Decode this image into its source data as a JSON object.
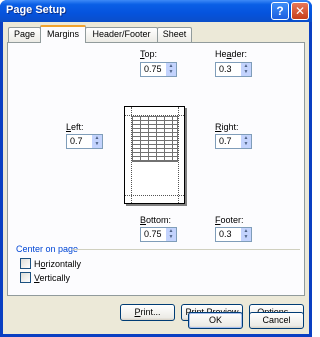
{
  "window": {
    "title": "Page Setup",
    "help_glyph": "?",
    "close_glyph": "✕"
  },
  "tabs": [
    {
      "label": "Page",
      "active": false
    },
    {
      "label": "Margins",
      "active": true
    },
    {
      "label": "Header/Footer",
      "active": false
    },
    {
      "label": "Sheet",
      "active": false
    }
  ],
  "margins": {
    "top": {
      "label_key": "T",
      "label_rest": "op:",
      "value": "0.75"
    },
    "header": {
      "label_pre": "He",
      "label_key": "a",
      "label_rest": "der:",
      "value": "0.3"
    },
    "left": {
      "label_key": "L",
      "label_rest": "eft:",
      "value": "0.7"
    },
    "right": {
      "label_key": "R",
      "label_rest": "ight:",
      "value": "0.7"
    },
    "bottom": {
      "label_key": "B",
      "label_rest": "ottom:",
      "value": "0.75"
    },
    "footer": {
      "label_key": "F",
      "label_rest": "ooter:",
      "value": "0.3"
    }
  },
  "center_on_page": {
    "title": "Center on page",
    "horizontally": {
      "label_key": "o",
      "label_pre": "H",
      "label_rest": "rizontally",
      "checked": false
    },
    "vertically": {
      "label_key": "V",
      "label_rest": "ertically",
      "checked": false
    }
  },
  "buttons": {
    "print": {
      "label_key": "P",
      "label_rest": "rint..."
    },
    "print_preview": {
      "label_pre": "Print Previe",
      "label_key": "w"
    },
    "options": {
      "label_key": "O",
      "label_rest": "ptions..."
    },
    "ok": "OK",
    "cancel": "Cancel"
  },
  "spin_up": "▲",
  "spin_down": "▼"
}
